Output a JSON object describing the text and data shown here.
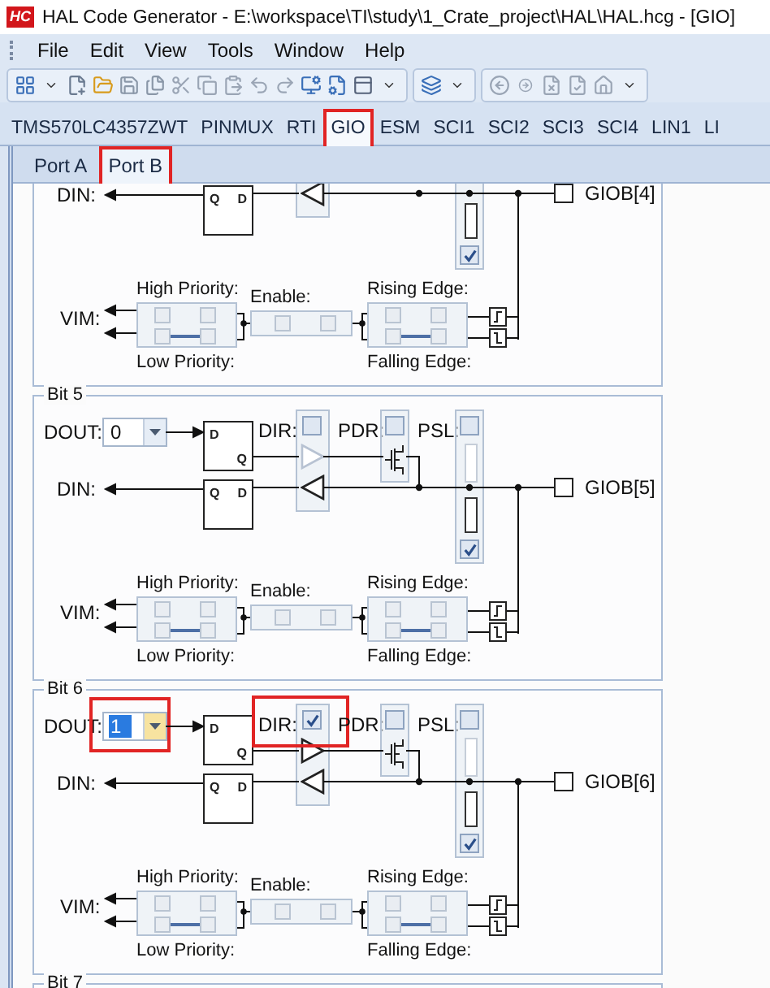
{
  "window": {
    "app_icon": "HC",
    "title": "HAL Code Generator - E:\\workspace\\TI\\study\\1_Crate_project\\HAL\\HAL.hcg - [GIO]"
  },
  "menu": [
    "File",
    "Edit",
    "View",
    "Tools",
    "Window",
    "Help"
  ],
  "module_tabs": [
    {
      "label": "TMS570LC4357ZWT",
      "selected": false,
      "highlight": false
    },
    {
      "label": "PINMUX",
      "selected": false,
      "highlight": false
    },
    {
      "label": "RTI",
      "selected": false,
      "highlight": false
    },
    {
      "label": "GIO",
      "selected": true,
      "highlight": true
    },
    {
      "label": "ESM",
      "selected": false,
      "highlight": false
    },
    {
      "label": "SCI1",
      "selected": false,
      "highlight": false
    },
    {
      "label": "SCI2",
      "selected": false,
      "highlight": false
    },
    {
      "label": "SCI3",
      "selected": false,
      "highlight": false
    },
    {
      "label": "SCI4",
      "selected": false,
      "highlight": false
    },
    {
      "label": "LIN1",
      "selected": false,
      "highlight": false
    },
    {
      "label": "LI",
      "selected": false,
      "highlight": false
    }
  ],
  "port_tabs": [
    {
      "label": "Port A",
      "selected": false,
      "highlight": false
    },
    {
      "label": "Port B",
      "selected": true,
      "highlight": true
    }
  ],
  "bits": [
    {
      "in_latch": {
        "output": "Q",
        "input": "D"
      },
      "din_label": "DIN:",
      "resistor_checkbox": {
        "checked": true
      },
      "pin": "GIOB[4]",
      "interrupts": {
        "vim_label": "VIM:",
        "high_priority": "High Priority:",
        "low_priority": "Low Priority:",
        "enable": "Enable:",
        "rising_edge": "Rising Edge:",
        "falling_edge": "Falling Edge:",
        "boxes": {
          "priority": [
            {
              "checked": false,
              "disabled": true
            },
            {
              "checked": false,
              "disabled": true
            },
            {
              "checked": false,
              "disabled": true
            },
            {
              "checked": false,
              "disabled": true
            }
          ],
          "enable": [
            {
              "checked": false,
              "disabled": true
            },
            {
              "checked": false,
              "disabled": true
            }
          ],
          "edge": [
            {
              "checked": false,
              "disabled": true
            },
            {
              "checked": false,
              "disabled": true
            },
            {
              "checked": false,
              "disabled": true
            },
            {
              "checked": false,
              "disabled": true
            }
          ]
        }
      }
    },
    {
      "title": "Bit 5",
      "dout": {
        "label": "DOUT:",
        "value": "0",
        "focused": false,
        "highlight": false
      },
      "out_latch": {
        "input": "D",
        "output": "Q"
      },
      "in_latch": {
        "output": "Q",
        "input": "D"
      },
      "din_label": "DIN:",
      "dir": {
        "label": "DIR:",
        "checked": false,
        "highlight": false
      },
      "pdr": {
        "label": "PDR:",
        "checked": false
      },
      "psl": {
        "label": "PSL:",
        "checked": false
      },
      "resistor_checkbox": {
        "checked": true
      },
      "pin": "GIOB[5]",
      "interrupts": {
        "vim_label": "VIM:",
        "high_priority": "High Priority:",
        "low_priority": "Low Priority:",
        "enable": "Enable:",
        "rising_edge": "Rising Edge:",
        "falling_edge": "Falling Edge:",
        "boxes": {
          "priority": [
            {
              "checked": false,
              "disabled": true
            },
            {
              "checked": false,
              "disabled": true
            },
            {
              "checked": false,
              "disabled": true
            },
            {
              "checked": false,
              "disabled": true
            }
          ],
          "enable": [
            {
              "checked": false,
              "disabled": true
            },
            {
              "checked": false,
              "disabled": true
            }
          ],
          "edge": [
            {
              "checked": false,
              "disabled": true
            },
            {
              "checked": false,
              "disabled": true
            },
            {
              "checked": false,
              "disabled": true
            },
            {
              "checked": false,
              "disabled": true
            }
          ]
        }
      }
    },
    {
      "title": "Bit 6",
      "dout": {
        "label": "DOUT:",
        "value": "1",
        "focused": true,
        "highlight": true
      },
      "out_latch": {
        "input": "D",
        "output": "Q"
      },
      "in_latch": {
        "output": "Q",
        "input": "D"
      },
      "din_label": "DIN:",
      "dir": {
        "label": "DIR:",
        "checked": true,
        "highlight": true
      },
      "pdr": {
        "label": "PDR:",
        "checked": false
      },
      "psl": {
        "label": "PSL:",
        "checked": false
      },
      "resistor_checkbox": {
        "checked": true
      },
      "pin": "GIOB[6]",
      "interrupts": {
        "vim_label": "VIM:",
        "high_priority": "High Priority:",
        "low_priority": "Low Priority:",
        "enable": "Enable:",
        "rising_edge": "Rising Edge:",
        "falling_edge": "Falling Edge:",
        "boxes": {
          "priority": [
            {
              "checked": false,
              "disabled": true
            },
            {
              "checked": false,
              "disabled": true
            },
            {
              "checked": false,
              "disabled": true
            },
            {
              "checked": false,
              "disabled": true
            }
          ],
          "enable": [
            {
              "checked": false,
              "disabled": true
            },
            {
              "checked": false,
              "disabled": true
            }
          ],
          "edge": [
            {
              "checked": false,
              "disabled": true
            },
            {
              "checked": false,
              "disabled": true
            },
            {
              "checked": false,
              "disabled": true
            },
            {
              "checked": false,
              "disabled": true
            }
          ]
        }
      }
    },
    {
      "title": "Bit 7"
    }
  ]
}
